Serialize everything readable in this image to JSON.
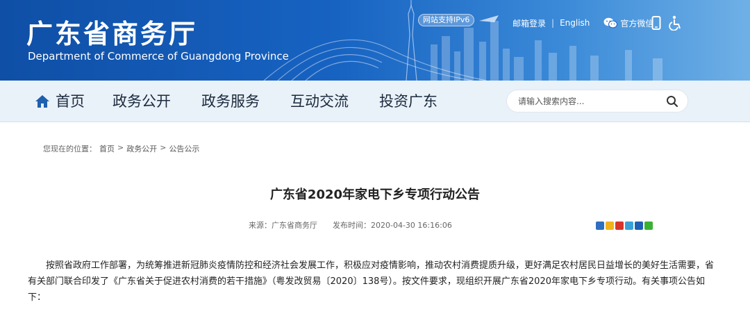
{
  "header": {
    "title": "广东省商务厅",
    "subtitle": "Department of Commerce of Guangdong Province",
    "ipv6_badge": "网站支持IPv6",
    "links": {
      "email_login": "邮箱登录",
      "separator": "|",
      "english": "English",
      "wechat": "官方微信"
    },
    "icons": [
      "mobile-icon",
      "accessibility-icon",
      "wechat-icon"
    ]
  },
  "nav": {
    "items": [
      "首页",
      "政务公开",
      "政务服务",
      "互动交流",
      "投资广东"
    ],
    "search_placeholder": "请输入搜索内容..."
  },
  "breadcrumb": {
    "prefix": "您现在的位置：",
    "items": [
      "首页",
      "政务公开",
      "公告公示"
    ],
    "separator": ">"
  },
  "article": {
    "title": "广东省2020年家电下乡专项行动公告",
    "source": "来源：广东省商务厅",
    "publish_time": "发布时间：2020-04-30 16:16:06",
    "body": "按照省政府工作部署，为统筹推进新冠肺炎疫情防控和经济社会发展工作，积极应对疫情影响，推动农村消费提质升级，更好满足农村居民日益增长的美好生活需要，省有关部门联合印发了《广东省关于促进农村消费的若干措施》（粤发改贸易〔2020〕138号）。按文件要求，现组织开展广东省2020年家电下乡专项行动。有关事项公告如下："
  },
  "colors": {
    "banner_start": "#0f4fa6",
    "banner_end": "#6fb0e6",
    "nav_bg": "#e9f1f9"
  },
  "share_icons": [
    "share-plus-icon",
    "qzone-icon",
    "weibo-icon",
    "tencent-weibo-icon",
    "renren-icon",
    "wechat-share-icon"
  ]
}
